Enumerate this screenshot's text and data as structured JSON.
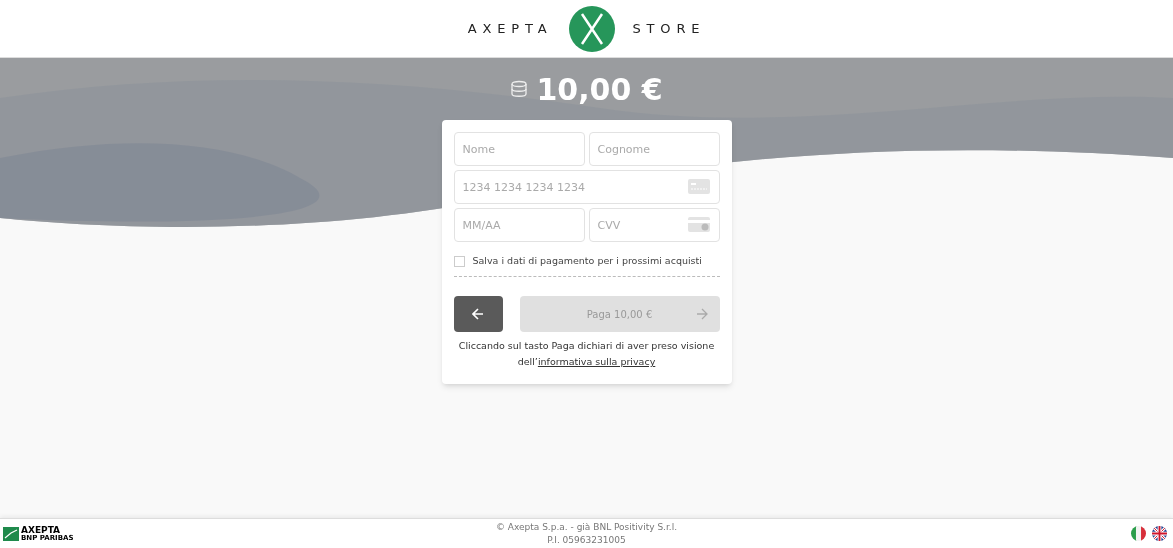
{
  "header": {
    "brand_left": "AXEPTA",
    "brand_right": "STORE"
  },
  "amount": "10,00 €",
  "form": {
    "fields": [
      {
        "placeholder": "Nome",
        "kind": "text"
      },
      {
        "placeholder": "Cognome",
        "kind": "text"
      },
      {
        "placeholder": "1234 1234 1234 1234",
        "kind": "card"
      },
      {
        "placeholder": "MM/AA",
        "kind": "text"
      },
      {
        "placeholder": "CVV",
        "kind": "cvv"
      }
    ],
    "save_checkbox": {
      "label": "Salva i dati di pagamento per i prossimi acquisti",
      "checked": false
    },
    "pay_button": {
      "label": "Paga 10,00 €",
      "disabled": true
    },
    "notice": "Cliccando sul tasto Paga dichiari di aver preso visione",
    "notice_prefix": "dell’",
    "privacy_link": "informativa sulla privacy"
  },
  "footer": {
    "logo_name": "AXEPTA",
    "logo_sub": "BNP PARIBAS",
    "copyright": "© Axepta S.p.a. - già BNL Positivity S.r.l.",
    "vat": "P.I. 05963231005"
  }
}
